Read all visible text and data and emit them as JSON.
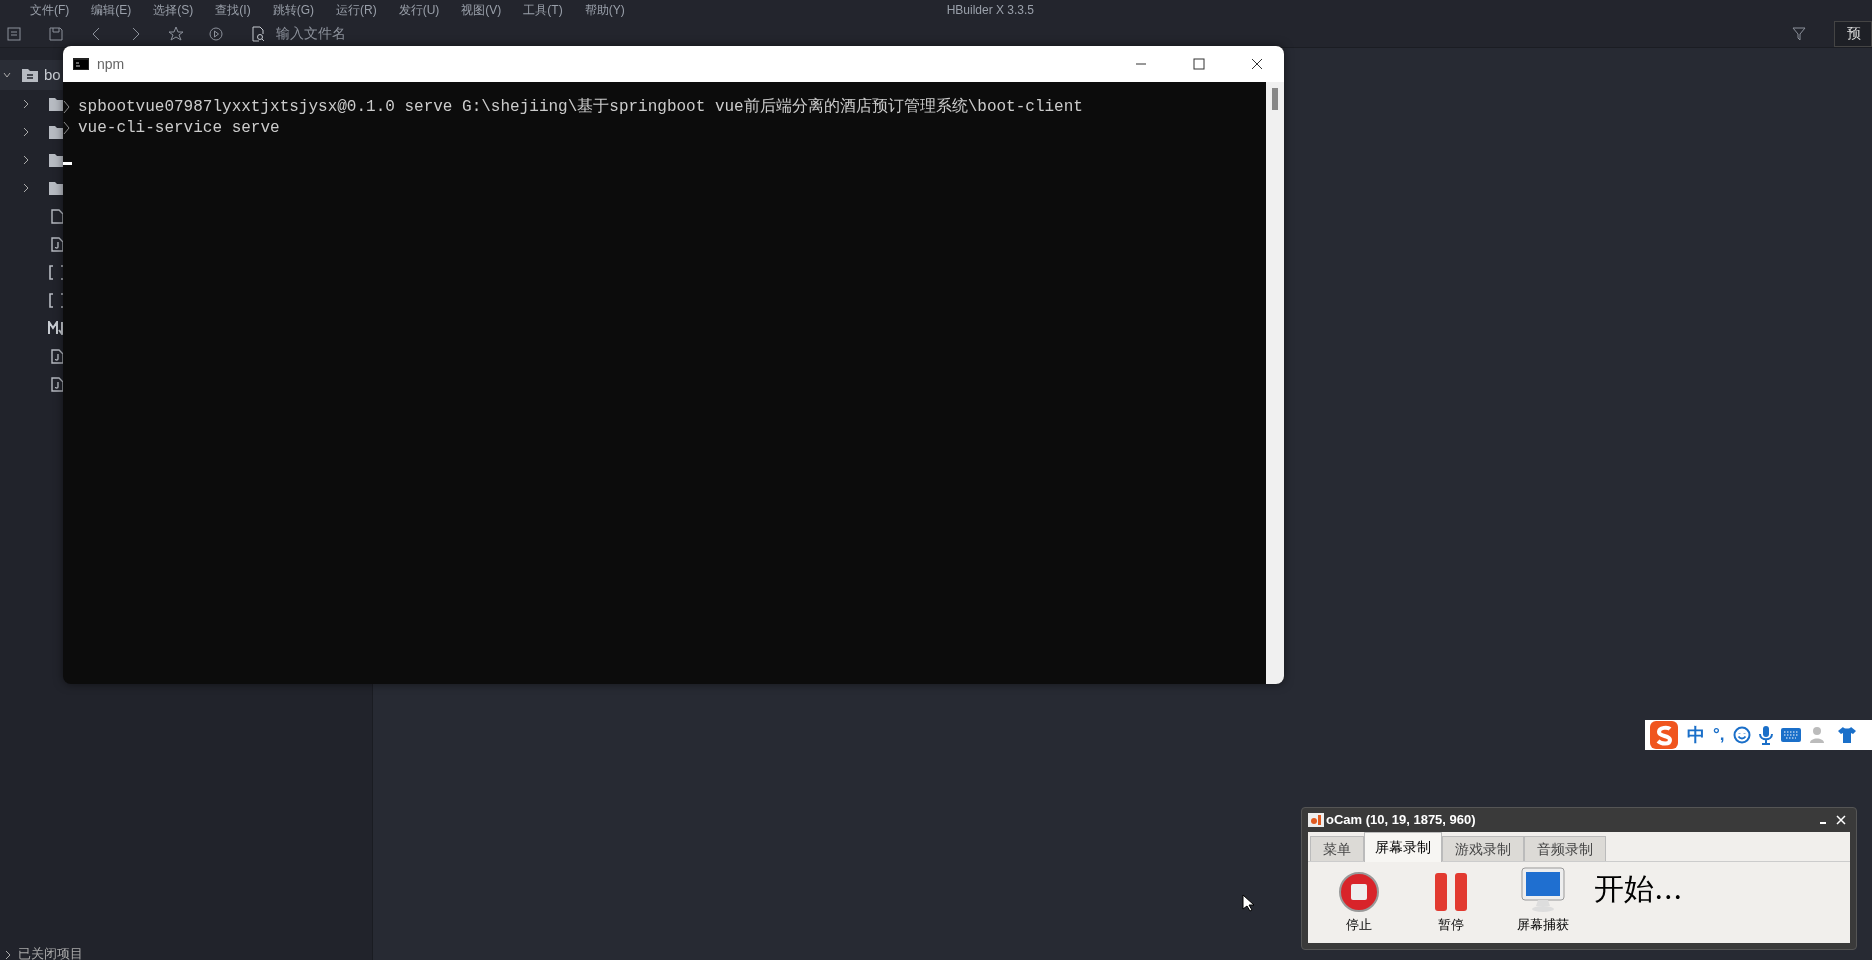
{
  "menu_bar": {
    "items": [
      "文件(F)",
      "编辑(E)",
      "选择(S)",
      "查找(I)",
      "跳转(G)",
      "运行(R)",
      "发行(U)",
      "视图(V)",
      "工具(T)",
      "帮助(Y)"
    ],
    "title": "HBuilder X 3.3.5"
  },
  "toolbar": {
    "search": {
      "placeholder": "输入文件名"
    },
    "preview_button": "预"
  },
  "sidebar": {
    "project": {
      "name": "bo",
      "expanded": true
    },
    "items": [
      {
        "kind": "folder",
        "expanded": false
      },
      {
        "kind": "folder",
        "expanded": false
      },
      {
        "kind": "folder",
        "expanded": false
      },
      {
        "kind": "folder",
        "expanded": false
      },
      {
        "kind": "file"
      },
      {
        "kind": "jsfile"
      },
      {
        "kind": "json"
      },
      {
        "kind": "json"
      },
      {
        "kind": "markdown"
      },
      {
        "kind": "jsfile"
      },
      {
        "kind": "jsfile"
      }
    ],
    "closed_projects": "已关闭项目"
  },
  "terminal": {
    "title": "npm",
    "lines": [
      "spbootvue07987lyxxtjxtsjysx@0.1.0 serve G:\\shejiing\\基于springboot vue前后端分离的酒店预订管理系统\\boot-client",
      "vue-cli-service serve"
    ]
  },
  "ime_bar": {
    "mode": "中",
    "punct": "°,"
  },
  "ocam": {
    "title": "oCam (10, 19, 1875, 960)",
    "tabs": [
      {
        "label": "菜单",
        "selected": false
      },
      {
        "label": "屏幕录制",
        "selected": true
      },
      {
        "label": "游戏录制",
        "selected": false
      },
      {
        "label": "音频录制",
        "selected": false
      }
    ],
    "buttons": [
      {
        "kind": "stop",
        "label": "停止"
      },
      {
        "kind": "pause",
        "label": "暂停"
      },
      {
        "kind": "capture",
        "label": "屏幕捕获"
      }
    ],
    "status": "开始..."
  }
}
